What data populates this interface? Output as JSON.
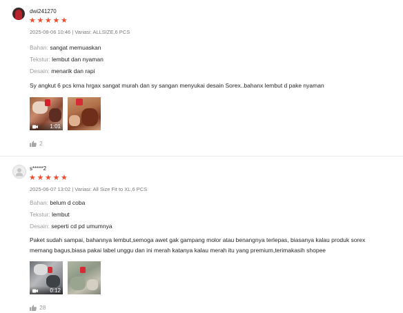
{
  "reviews": [
    {
      "username": "dwi241270",
      "rating": 5,
      "meta": "2025-08-06 10:46 | Variasi: ALLSIZE,6 PCS",
      "attributes": [
        {
          "key": "Bahan:",
          "value": "sangat memuaskan"
        },
        {
          "key": "Tekstur:",
          "value": "lembut dan nyaman"
        },
        {
          "key": "Desain:",
          "value": "menarik dan rapi"
        }
      ],
      "comment": "Sy angkut 6 pcs krna hrgax sangat murah dan sy sangan menyukai desain Sorex..bahanx lembut d pake nyaman",
      "media": [
        {
          "type": "video",
          "duration": "1:01"
        },
        {
          "type": "image"
        }
      ],
      "likes": "2"
    },
    {
      "username": "s*****2",
      "rating": 5,
      "meta": "2025-06-07 13:02 | Variasi: All Size Fit to XL,6 PCS",
      "attributes": [
        {
          "key": "Bahan:",
          "value": "belum d coba"
        },
        {
          "key": "Tekstur:",
          "value": "lembut"
        },
        {
          "key": "Desain:",
          "value": "seperti cd pd umumnya"
        }
      ],
      "comment_lines": [
        "Paket sudah sampai, bahannya lembut,semoga awet gak gampang molor atau benangnya terlepas, biasanya kalau produk sorex",
        "memang bagus,biasa pakai label unggu dan ini merah katanya kalau merah itu yang premium,terimakasih shopee"
      ],
      "media": [
        {
          "type": "video",
          "duration": "0:12"
        },
        {
          "type": "image"
        }
      ],
      "likes": "28"
    }
  ],
  "icons": {
    "star": "star-icon",
    "like": "thumbs-up-icon",
    "video": "video-camera-icon",
    "avatar_default": "default-user-icon"
  },
  "colors": {
    "star": "#ee4d2d",
    "muted": "#a6a6a6"
  }
}
